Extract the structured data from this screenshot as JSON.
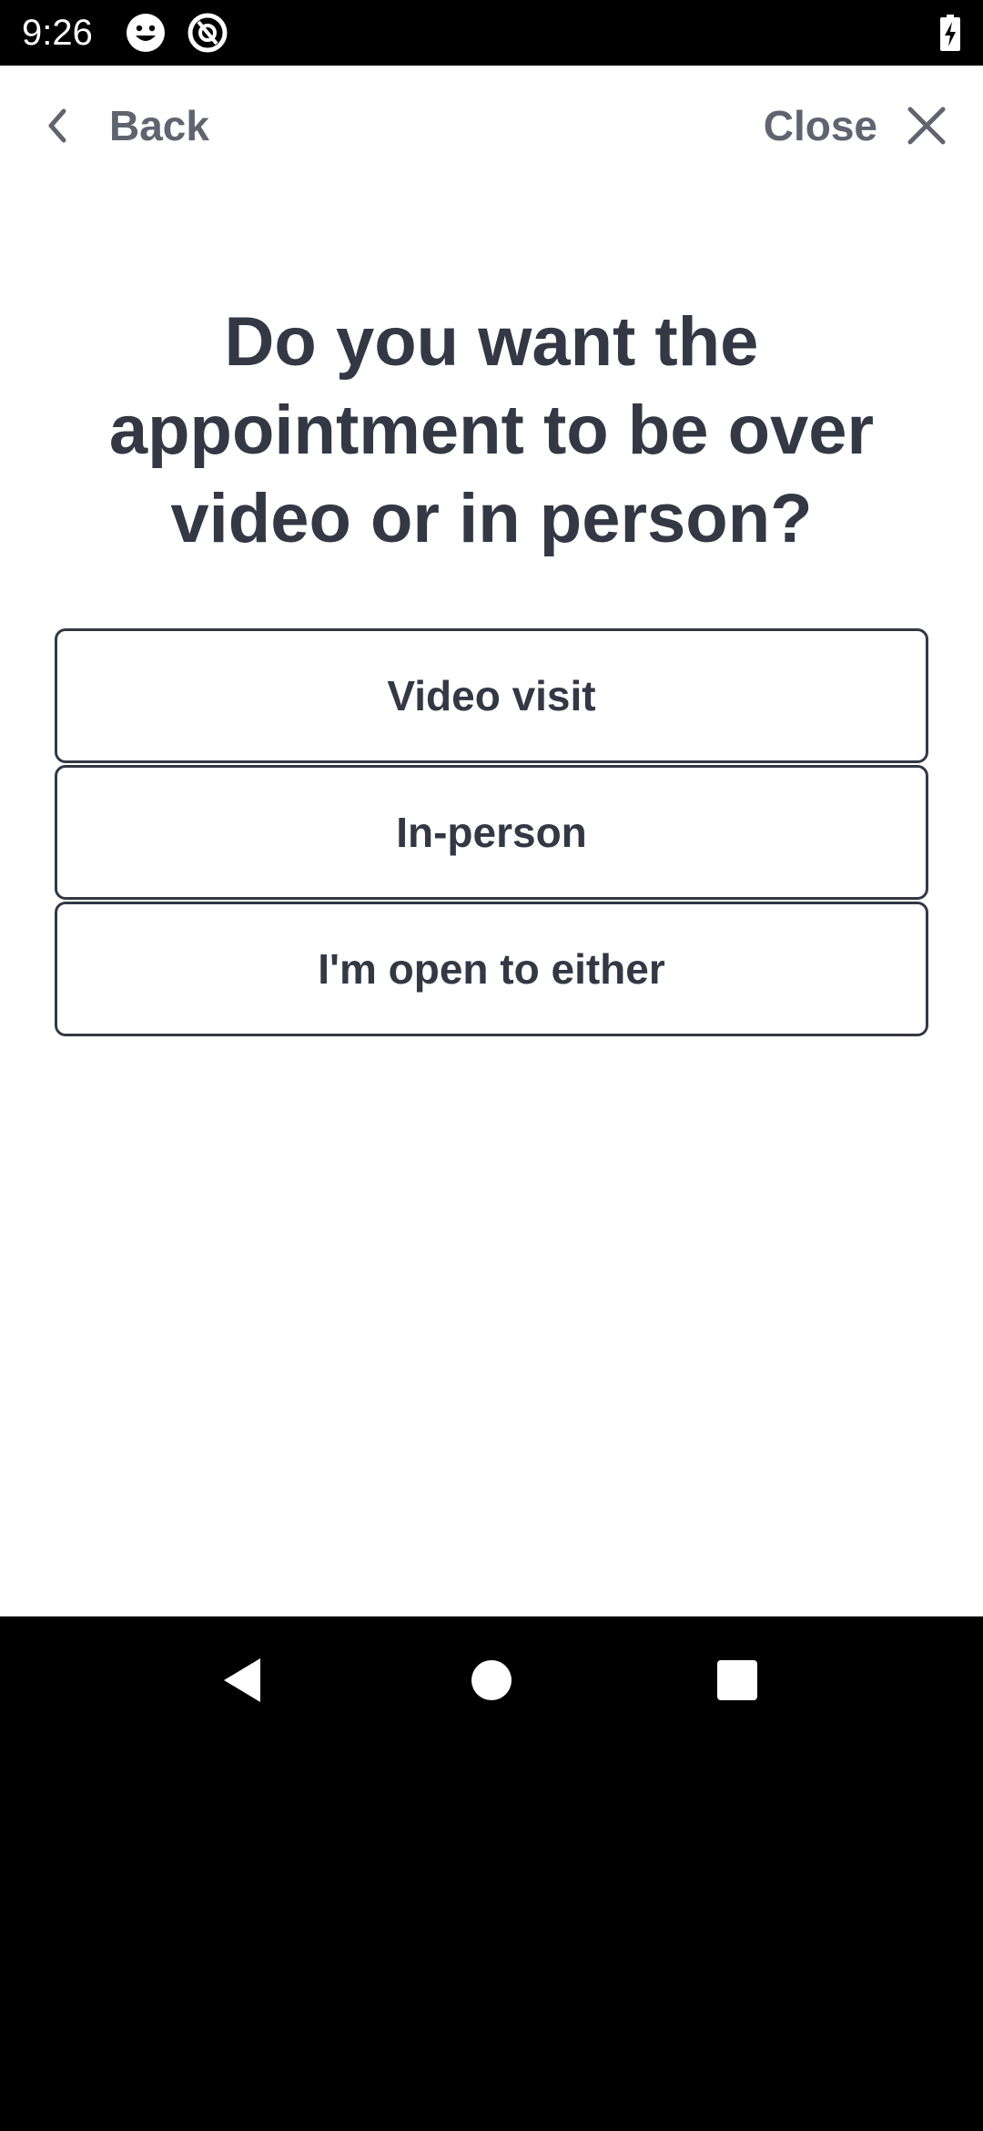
{
  "status_bar": {
    "time": "9:26",
    "icons": [
      "smiley-icon",
      "assistant-icon",
      "battery-charging-icon"
    ]
  },
  "header": {
    "back_label": "Back",
    "close_label": "Close",
    "back_icon": "chevron-left-icon",
    "close_icon": "close-icon"
  },
  "question": {
    "text": "Do you want the appointment to be over video or in person?"
  },
  "options": [
    {
      "label": "Video visit"
    },
    {
      "label": "In-person"
    },
    {
      "label": "I'm open to either"
    }
  ],
  "nav_bar": {
    "icons": [
      "nav-back-icon",
      "nav-home-icon",
      "nav-recents-icon"
    ]
  },
  "colors": {
    "text_primary": "#333844",
    "text_secondary": "#5f6470",
    "background": "#ffffff",
    "system_bar": "#000000"
  }
}
